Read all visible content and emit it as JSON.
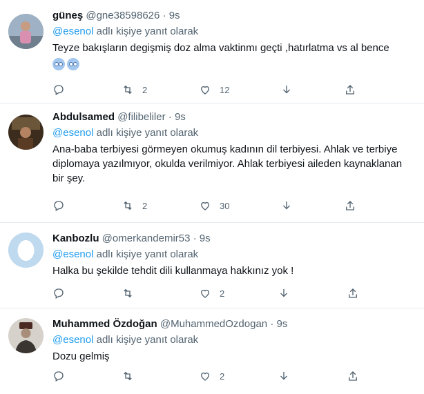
{
  "reply_prefix": "adlı kişiye yanıt olarak",
  "mention": "@esenol",
  "tweets": [
    {
      "name": "güneş",
      "handle": "@gne38598626",
      "time": "9s",
      "text": "Teyze bakışların degişmiş doz alma vaktinmı geçti ,hatırlatma vs al bence",
      "emojis": [
        "face-emoji",
        "face-emoji"
      ],
      "retweets": "2",
      "likes": "12"
    },
    {
      "name": "Abdulsamed",
      "handle": "@filibeliler",
      "time": "9s",
      "text": "Ana-baba terbiyesi görmeyen okumuş kadının dil terbiyesi. Ahlak ve terbiye diplomaya yazılmıyor, okulda verilmiyor. Ahlak terbiyesi aileden kaynaklanan bir şey.",
      "retweets": "2",
      "likes": "30"
    },
    {
      "name": "Kanbozlu",
      "handle": "@omerkandemir53",
      "time": "9s",
      "text": "Halka bu şekilde tehdit dili kullanmaya hakkınız yok !",
      "retweets": "",
      "likes": "2"
    },
    {
      "name": "Muhammed Özdoğan",
      "handle": "@MuhammedOzdogan",
      "time": "9s",
      "text": "Dozu gelmiş",
      "retweets": "",
      "likes": "2"
    }
  ]
}
